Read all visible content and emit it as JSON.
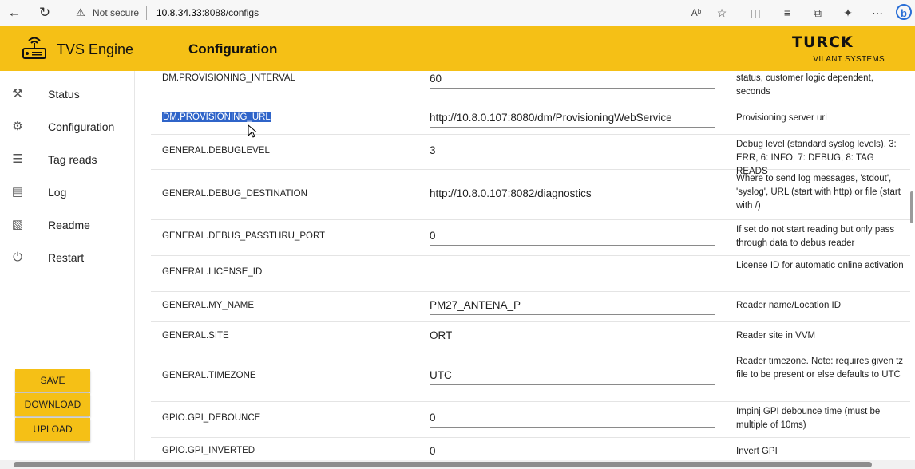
{
  "browser": {
    "security_label": "Not secure",
    "url_host": "10.8.34.33",
    "url_rest": ":8088/configs",
    "icons": [
      "back-icon",
      "refresh-icon",
      "warning-icon",
      "read-aloud-icon",
      "favorite-icon",
      "split-screen-icon",
      "favorites-list-icon",
      "collections-icon",
      "extensions-icon",
      "more-icon",
      "bing-icon"
    ]
  },
  "header": {
    "app_name": "TVS Engine",
    "page_title": "Configuration",
    "brand": "TURCK",
    "brand_sub": "VILANT SYSTEMS",
    "color": "#f5c016"
  },
  "sidebar": {
    "items": [
      {
        "label": "Status",
        "icon": "hammer-icon"
      },
      {
        "label": "Configuration",
        "icon": "gear-icon"
      },
      {
        "label": "Tag reads",
        "icon": "list-icon"
      },
      {
        "label": "Log",
        "icon": "log-icon"
      },
      {
        "label": "Readme",
        "icon": "book-icon"
      },
      {
        "label": "Restart",
        "icon": "power-icon"
      }
    ],
    "buttons": {
      "save": "SAVE",
      "download": "DOWNLOAD",
      "upload": "UPLOAD"
    }
  },
  "configs": [
    {
      "key": "DM.PROVISIONING_INTERVAL",
      "value": "60",
      "desc": "status, customer logic dependent, seconds"
    },
    {
      "key": "DM.PROVISIONING_URL",
      "value": "http://10.8.0.107:8080/dm/ProvisioningWebService",
      "desc": "Provisioning server url"
    },
    {
      "key": "GENERAL.DEBUGLEVEL",
      "value": "3",
      "desc": "Debug level (standard syslog levels), 3: ERR, 6: INFO, 7: DEBUG, 8: TAG READS"
    },
    {
      "key": "GENERAL.DEBUG_DESTINATION",
      "value": "http://10.8.0.107:8082/diagnostics",
      "desc": "Where to send log messages, 'stdout', 'syslog', URL (start with http) or file (start with /)"
    },
    {
      "key": "GENERAL.DEBUS_PASSTHRU_PORT",
      "value": "0",
      "desc": "If set do not start reading but only pass through data to debus reader"
    },
    {
      "key": "GENERAL.LICENSE_ID",
      "value": "",
      "desc": "License ID for automatic online activation"
    },
    {
      "key": "GENERAL.MY_NAME",
      "value": "PM27_ANTENA_P",
      "desc": "Reader name/Location ID"
    },
    {
      "key": "GENERAL.SITE",
      "value": "ORT",
      "desc": "Reader site in VVM"
    },
    {
      "key": "GENERAL.TIMEZONE",
      "value": "UTC",
      "desc": "Reader timezone. Note: requires given tz file to be present or else defaults to UTC"
    },
    {
      "key": "GPIO.GPI_DEBOUNCE",
      "value": "0",
      "desc": "Impinj GPI debounce time (must be multiple of 10ms)"
    },
    {
      "key": "GPIO.GPI_INVERTED",
      "value": "0",
      "desc": "Invert GPI"
    }
  ]
}
